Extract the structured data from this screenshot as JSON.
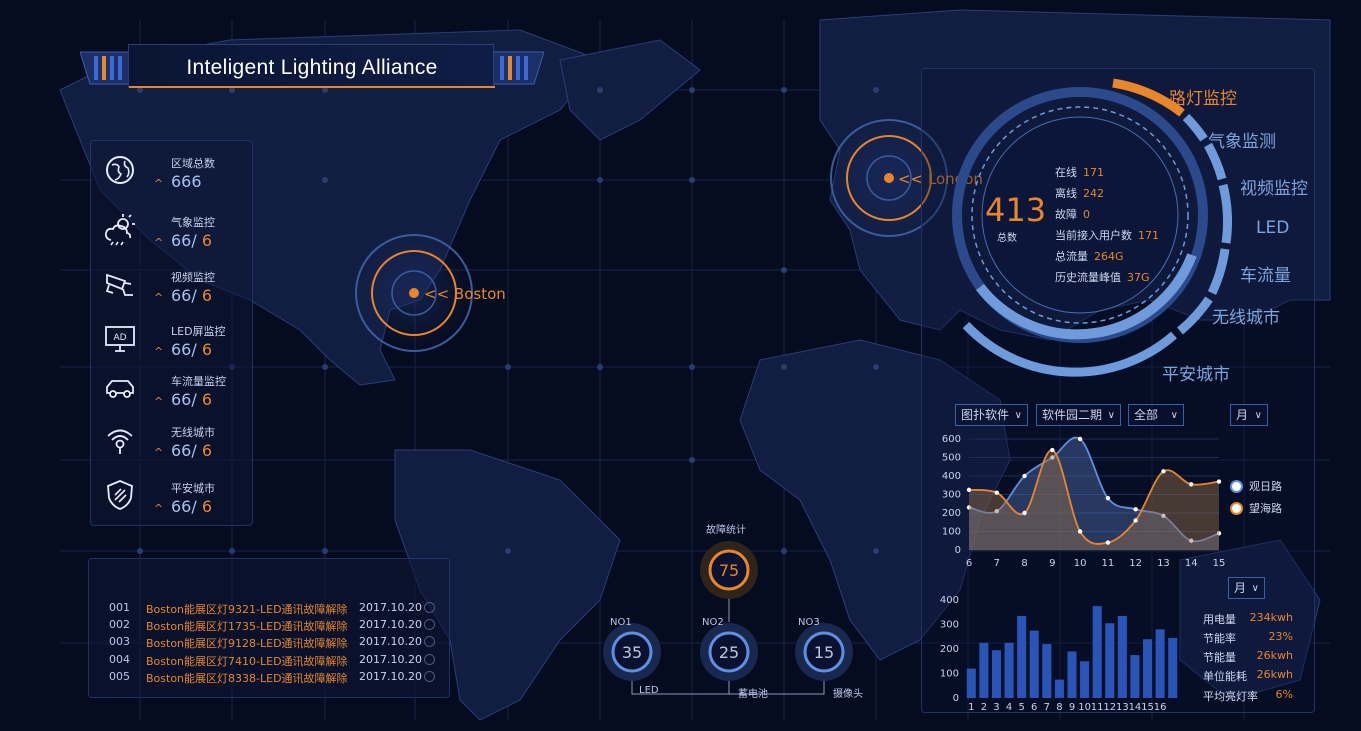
{
  "header": {
    "title": "Inteligent Lighting Alliance"
  },
  "map": {
    "markers": [
      {
        "name": "Boston",
        "label": "<< Boston"
      },
      {
        "name": "London",
        "label": "<< London"
      }
    ]
  },
  "left_stats": [
    {
      "icon": "globe-icon",
      "label": "区域总数",
      "value": "666",
      "total": ""
    },
    {
      "icon": "weather-icon",
      "label": "气象监控",
      "value": "66",
      "total": "6"
    },
    {
      "icon": "camera-icon",
      "label": "视频监控",
      "value": "66",
      "total": "6"
    },
    {
      "icon": "led-screen-icon",
      "label": "LED屏监控",
      "value": "66",
      "total": "6"
    },
    {
      "icon": "car-icon",
      "label": "车流量监控",
      "value": "66",
      "total": "6"
    },
    {
      "icon": "wireless-icon",
      "label": "无线城市",
      "value": "66",
      "total": "6"
    },
    {
      "icon": "shield-icon",
      "label": "平安城市",
      "value": "66",
      "total": "6"
    }
  ],
  "fault_list": [
    {
      "no": "001",
      "msg": "Boston能展区灯9321-LED通讯故障解除",
      "date": "2017.10.20"
    },
    {
      "no": "002",
      "msg": "Boston能展区灯1735-LED通讯故障解除",
      "date": "2017.10.20"
    },
    {
      "no": "003",
      "msg": "Boston能展区灯9128-LED通讯故障解除",
      "date": "2017.10.20"
    },
    {
      "no": "004",
      "msg": "Boston能展区灯7410-LED通讯故障解除",
      "date": "2017.10.20"
    },
    {
      "no": "005",
      "msg": "Boston能展区灯8338-LED通讯故障解除",
      "date": "2017.10.20"
    }
  ],
  "fault_stats": {
    "title": "故障统计",
    "total": "75",
    "items": [
      {
        "rank": "NO1",
        "value": "35",
        "label": "LED"
      },
      {
        "rank": "NO2",
        "value": "25",
        "label": "蓄电池"
      },
      {
        "rank": "NO3",
        "value": "15",
        "label": "摄像头"
      }
    ]
  },
  "ring": {
    "total": "413",
    "total_label": "总数",
    "categories": [
      "路灯监控",
      "气象监测",
      "视频监控",
      "LED",
      "车流量",
      "无线城市",
      "平安城市"
    ],
    "active_category": "路灯监控",
    "info": [
      {
        "label": "在线",
        "value": "171"
      },
      {
        "label": "离线",
        "value": "242"
      },
      {
        "label": "故障",
        "value": "0"
      },
      {
        "label": "当前接入用户数",
        "value": "171"
      },
      {
        "label": "总流量",
        "value": "264G"
      },
      {
        "label": "历史流量峰值",
        "value": "37G"
      }
    ]
  },
  "filters": {
    "software": "图扑软件",
    "park": "软件园二期",
    "scope": "全部",
    "period": "月",
    "period2": "月"
  },
  "energy": [
    {
      "label": "用电量",
      "value": "234kwh"
    },
    {
      "label": "节能率",
      "value": "23%"
    },
    {
      "label": "节能量",
      "value": "26kwh"
    },
    {
      "label": "单位能耗",
      "value": "26kwh"
    },
    {
      "label": "平均亮灯率",
      "value": "6%"
    }
  ],
  "colors": {
    "accent": "#e8862c",
    "primary": "#5f8fe0",
    "bg": "#060c1f",
    "panel_border": "#1f3366"
  },
  "chart_data": [
    {
      "type": "area",
      "x": [
        6,
        7,
        8,
        9,
        10,
        11,
        12,
        13,
        14,
        15
      ],
      "series": [
        {
          "name": "观日路",
          "values": [
            230,
            210,
            400,
            500,
            600,
            280,
            220,
            185,
            50,
            90
          ]
        },
        {
          "name": "望海路",
          "values": [
            325,
            310,
            200,
            540,
            100,
            40,
            160,
            425,
            355,
            370
          ]
        }
      ],
      "ylim": [
        0,
        600
      ],
      "yticks": [
        0,
        100,
        200,
        300,
        400,
        500,
        600
      ],
      "grid": true,
      "legend": "right"
    },
    {
      "type": "bar",
      "categories": [
        "1",
        "2",
        "3",
        "4",
        "5",
        "6",
        "7",
        "8",
        "9",
        "10",
        "11",
        "12",
        "13",
        "14",
        "15",
        "16"
      ],
      "values": [
        120,
        225,
        195,
        225,
        335,
        275,
        220,
        75,
        190,
        150,
        375,
        305,
        335,
        175,
        240,
        280,
        245
      ],
      "ylim": [
        0,
        400
      ],
      "yticks": [
        0,
        100,
        200,
        300,
        400
      ]
    }
  ]
}
